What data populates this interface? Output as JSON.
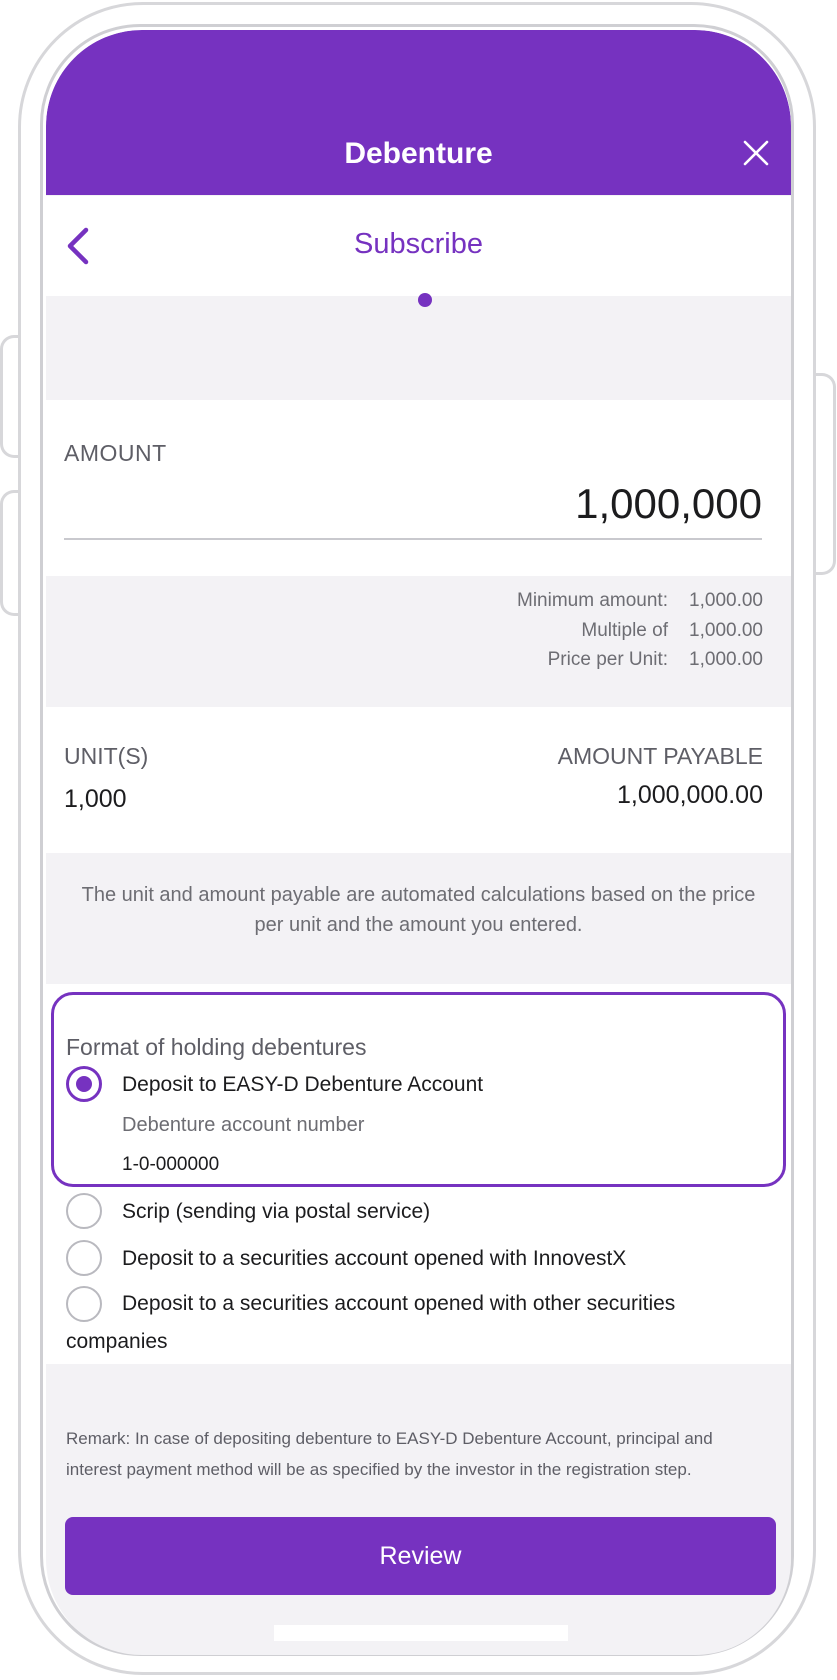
{
  "header": {
    "title": "Debenture",
    "close_icon": "close-icon"
  },
  "subheader": {
    "title": "Subscribe",
    "back_icon": "chevron-left-icon"
  },
  "amount": {
    "label": "AMOUNT",
    "value": "1,000,000",
    "limits": [
      {
        "key": "Minimum amount:",
        "value": "1,000.00"
      },
      {
        "key": "Multiple of",
        "value": "1,000.00"
      },
      {
        "key": "Price per Unit:",
        "value": "1,000.00"
      }
    ]
  },
  "units": {
    "label": "UNIT(S)",
    "value": "1,000"
  },
  "payable": {
    "label": "AMOUNT PAYABLE",
    "value": "1,000,000.00"
  },
  "calc_note": "The unit and amount payable are automated calculations based on the price per unit and the amount you entered.",
  "holding": {
    "title": "Format of holding debentures",
    "selected_option": "easy_d",
    "options": {
      "easy_d": "Deposit to EASY-D Debenture Account",
      "scrip": "Scrip (sending via postal service)",
      "innovestx": "Deposit to a securities account opened with InnovestX",
      "other": "Deposit to a securities account opened with other securities companies"
    },
    "account_number_label": "Debenture account number",
    "account_number_value": "1-0-000000"
  },
  "remark": "Remark: In case of depositing debenture to EASY-D Debenture Account, principal and interest payment method will be as specified by the investor in the registration step.",
  "review_button": "Review",
  "colors": {
    "accent": "#7632c0",
    "background": "#f3f2f5",
    "card": "#ffffff"
  }
}
